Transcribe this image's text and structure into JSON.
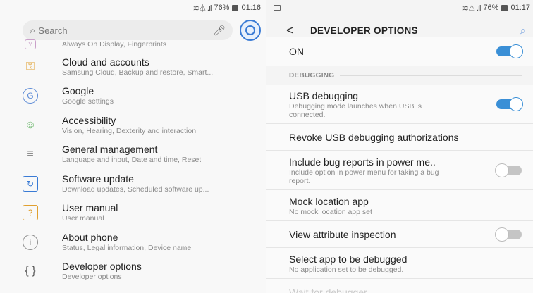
{
  "left_status": {
    "signal": "≋⏃ .ıl",
    "battery": "76%",
    "time": "01:16"
  },
  "search": {
    "placeholder": "Search"
  },
  "settings_items": [
    {
      "title": "",
      "sub": "Always On Display, Fingerprints",
      "icon": "lock-screen-icon",
      "color": "#c9a0c9"
    },
    {
      "title": "Cloud and accounts",
      "sub": "Samsung Cloud, Backup and restore, Smart...",
      "icon": "key-icon",
      "color": "#e0a030"
    },
    {
      "title": "Google",
      "sub": "Google settings",
      "icon": "google-icon",
      "color": "#5b8ad6"
    },
    {
      "title": "Accessibility",
      "sub": "Vision, Hearing, Dexterity and interaction",
      "icon": "accessibility-icon",
      "color": "#6fb86f"
    },
    {
      "title": "General management",
      "sub": "Language and input, Date and time, Reset",
      "icon": "sliders-icon",
      "color": "#8d8d8d"
    },
    {
      "title": "Software update",
      "sub": "Download updates, Scheduled software up...",
      "icon": "software-update-icon",
      "color": "#3a7bd5"
    },
    {
      "title": "User manual",
      "sub": "User manual",
      "icon": "user-manual-icon",
      "color": "#e0a030"
    },
    {
      "title": "About phone",
      "sub": "Status, Legal information, Device name",
      "icon": "info-icon",
      "color": "#8d8d8d"
    },
    {
      "title": "Developer options",
      "sub": "Developer options",
      "icon": "braces-icon",
      "color": "#555555"
    }
  ],
  "right_status": {
    "signal": "≋⏃ .ıl",
    "battery": "76%",
    "time": "01:17"
  },
  "appbar": {
    "back": "<",
    "title": "DEVELOPER OPTIONS"
  },
  "master": {
    "label": "ON",
    "state": "on"
  },
  "section": {
    "label": "DEBUGGING"
  },
  "dev_rows": [
    {
      "title": "USB debugging",
      "sub": "Debugging mode launches when USB is connected.",
      "toggle": "on"
    },
    {
      "title": "Revoke USB debugging authorizations",
      "sub": "",
      "toggle": ""
    },
    {
      "title": "Include bug reports in power me..",
      "sub": "Include option in power menu for taking a bug report.",
      "toggle": "off"
    },
    {
      "title": "Mock location app",
      "sub": "No mock location app set",
      "toggle": ""
    },
    {
      "title": "View attribute inspection",
      "sub": "",
      "toggle": "off"
    },
    {
      "title": "Select app to be debugged",
      "sub": "No application set to be debugged.",
      "toggle": ""
    },
    {
      "title": "Wait for debugger",
      "sub": "",
      "toggle": "",
      "dim": true
    }
  ]
}
